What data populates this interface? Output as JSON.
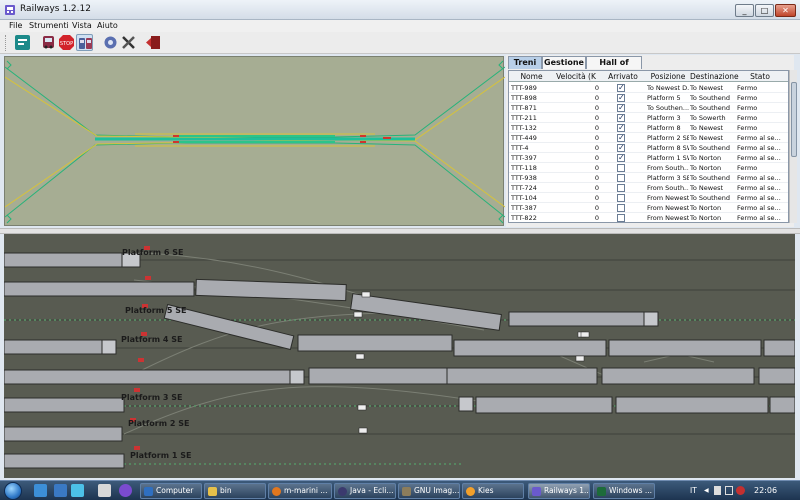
{
  "window": {
    "title": "Railways 1.2.12",
    "min": "_",
    "max": "□",
    "close": "✕"
  },
  "menu": [
    "File",
    "Strumenti",
    "Vista",
    "Aiuto"
  ],
  "toolbar": [
    "layout-icon",
    "train-icon",
    "stop-icon",
    "trains-icon",
    "settings-icon",
    "tools-icon",
    "exit-icon"
  ],
  "tabs": [
    {
      "label": "Treni",
      "active": true
    },
    {
      "label": "Gestione",
      "active": false
    },
    {
      "label": "Hall of Fame",
      "active": false
    }
  ],
  "table": {
    "columns": [
      "Nome",
      "Velocità (K",
      "Arrivato",
      "Posizione",
      "Destinazione",
      "Stato"
    ],
    "rows": [
      {
        "name": "TTT-989",
        "speed": "0",
        "arrived": true,
        "position": "To Newest D...",
        "dest": "To Newest",
        "state": "Fermo"
      },
      {
        "name": "TTT-898",
        "speed": "0",
        "arrived": true,
        "position": "Platform 5",
        "dest": "To Southend",
        "state": "Fermo"
      },
      {
        "name": "TTT-871",
        "speed": "0",
        "arrived": true,
        "position": "To Southen...",
        "dest": "To Southend",
        "state": "Fermo"
      },
      {
        "name": "TTT-211",
        "speed": "0",
        "arrived": true,
        "position": "Platform 3",
        "dest": "To Sowerth",
        "state": "Fermo"
      },
      {
        "name": "TTT-132",
        "speed": "0",
        "arrived": true,
        "position": "Platform 8",
        "dest": "To Newest",
        "state": "Fermo"
      },
      {
        "name": "TTT-449",
        "speed": "0",
        "arrived": true,
        "position": "Platform 2 SE",
        "dest": "To Newest",
        "state": "Fermo al se..."
      },
      {
        "name": "TTT-4",
        "speed": "0",
        "arrived": true,
        "position": "Platform 8 SW",
        "dest": "To Southend",
        "state": "Fermo al se..."
      },
      {
        "name": "TTT-397",
        "speed": "0",
        "arrived": true,
        "position": "Platform 1 SW",
        "dest": "To Norton",
        "state": "Fermo al se..."
      },
      {
        "name": "TTT-118",
        "speed": "0",
        "arrived": false,
        "position": "From South...",
        "dest": "To Norton",
        "state": "Fermo"
      },
      {
        "name": "TTT-938",
        "speed": "0",
        "arrived": false,
        "position": "Platform 3 SE",
        "dest": "To Southend",
        "state": "Fermo al se..."
      },
      {
        "name": "TTT-724",
        "speed": "0",
        "arrived": false,
        "position": "From South...",
        "dest": "To Newest",
        "state": "Fermo al se..."
      },
      {
        "name": "TTT-104",
        "speed": "0",
        "arrived": false,
        "position": "From Newest...",
        "dest": "To Southend",
        "state": "Fermo al se..."
      },
      {
        "name": "TTT-387",
        "speed": "0",
        "arrived": false,
        "position": "From Newest",
        "dest": "To Norton",
        "state": "Fermo al se..."
      },
      {
        "name": "TTT-822",
        "speed": "0",
        "arrived": false,
        "position": "From Newest",
        "dest": "To Norton",
        "state": "Fermo al se..."
      }
    ]
  },
  "detail": {
    "platform_labels": [
      "Platform 6 SE",
      "Platform 5 SE",
      "Platform 4 SE",
      "Platform 3 SE",
      "Platform 2 SE",
      "Platform 1 SE"
    ]
  },
  "taskbar": {
    "items": [
      {
        "label": "Computer",
        "active": false
      },
      {
        "label": "bin",
        "active": false
      },
      {
        "label": "m-marini ...",
        "active": false
      },
      {
        "label": "Java - Ecli...",
        "active": false
      },
      {
        "label": "GNU Imag...",
        "active": false
      },
      {
        "label": "Kies",
        "active": false
      },
      {
        "label": "Railways 1....",
        "active": true
      },
      {
        "label": "Windows ...",
        "active": false
      }
    ],
    "lang": "IT",
    "clock": "22:06"
  }
}
